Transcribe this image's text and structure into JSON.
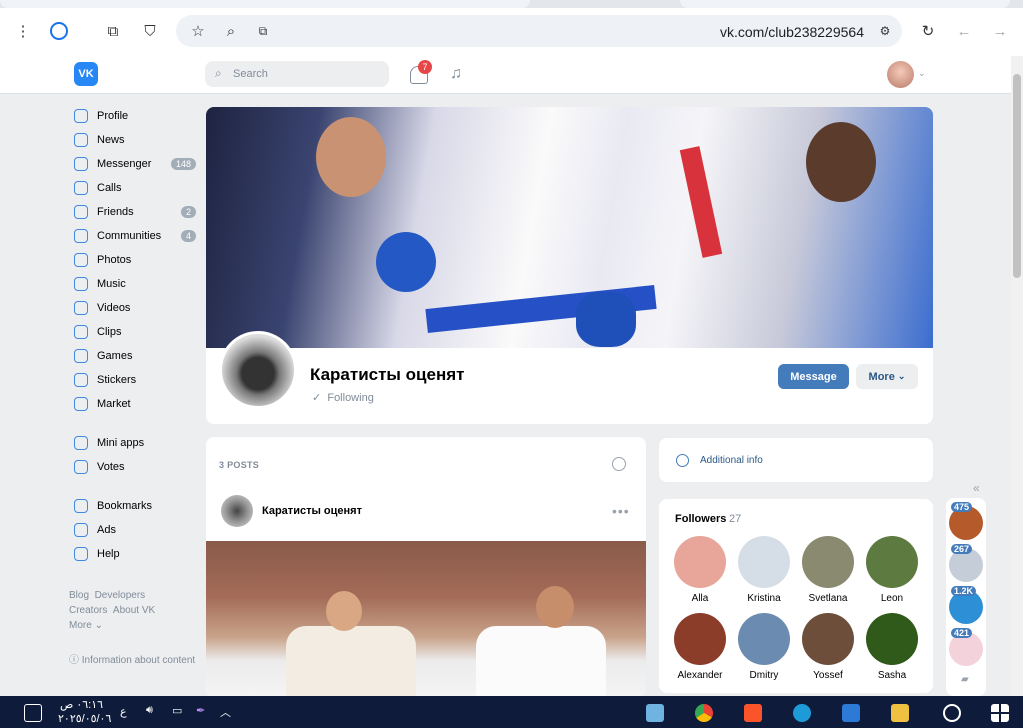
{
  "browser": {
    "url": "vk.com/club238229564"
  },
  "header": {
    "logo": "VK",
    "search_placeholder": "Search",
    "notifications_count": "7"
  },
  "sidebar": {
    "items": [
      {
        "label": "Profile",
        "icon": "profile-icon",
        "count": ""
      },
      {
        "label": "News",
        "icon": "news-icon",
        "count": ""
      },
      {
        "label": "Messenger",
        "icon": "messenger-icon",
        "count": "148"
      },
      {
        "label": "Calls",
        "icon": "calls-icon",
        "count": ""
      },
      {
        "label": "Friends",
        "icon": "friends-icon",
        "count": "2"
      },
      {
        "label": "Communities",
        "icon": "communities-icon",
        "count": "4"
      },
      {
        "label": "Photos",
        "icon": "photos-icon",
        "count": ""
      },
      {
        "label": "Music",
        "icon": "music-icon",
        "count": ""
      },
      {
        "label": "Videos",
        "icon": "videos-icon",
        "count": ""
      },
      {
        "label": "Clips",
        "icon": "clips-icon",
        "count": ""
      },
      {
        "label": "Games",
        "icon": "games-icon",
        "count": ""
      },
      {
        "label": "Stickers",
        "icon": "stickers-icon",
        "count": ""
      },
      {
        "label": "Market",
        "icon": "market-icon",
        "count": ""
      }
    ],
    "items2": [
      {
        "label": "Mini apps",
        "icon": "mini-apps-icon"
      },
      {
        "label": "Votes",
        "icon": "votes-icon"
      }
    ],
    "items3": [
      {
        "label": "Bookmarks",
        "icon": "bookmarks-icon"
      },
      {
        "label": "Ads",
        "icon": "ads-icon"
      },
      {
        "label": "Help",
        "icon": "help-icon"
      }
    ],
    "footer": {
      "blog": "Blog",
      "developers": "Developers",
      "creators": "Creators",
      "about": "About VK",
      "more": "More",
      "info": "Information about content"
    }
  },
  "group": {
    "title": "Каратисты оценят",
    "following": "Following",
    "message_btn": "Message",
    "more_btn": "More"
  },
  "posts": {
    "header": "3 POSTS",
    "author": "Каратисты оценят"
  },
  "additional_info": "Additional info",
  "followers": {
    "title": "Followers",
    "count": "27",
    "list": [
      {
        "name": "Alla",
        "color": "#e8a59a"
      },
      {
        "name": "Kristina",
        "color": "#d5dde6"
      },
      {
        "name": "Svetlana",
        "color": "#8a8a70"
      },
      {
        "name": "Leon",
        "color": "#5d7a40"
      },
      {
        "name": "Alexander",
        "color": "#8b3d2a"
      },
      {
        "name": "Dmitry",
        "color": "#6b8bb0"
      },
      {
        "name": "Yossef",
        "color": "#6d4e3a"
      },
      {
        "name": "Sasha",
        "color": "#2f5a1a"
      }
    ]
  },
  "right_bar": {
    "counts": [
      "475",
      "267",
      "1.2K",
      "421"
    ]
  },
  "taskbar": {
    "time": "٠٦:١٦ ص",
    "date": "٢٠٢٥/٠٥/٠٦",
    "lang": "ع"
  }
}
